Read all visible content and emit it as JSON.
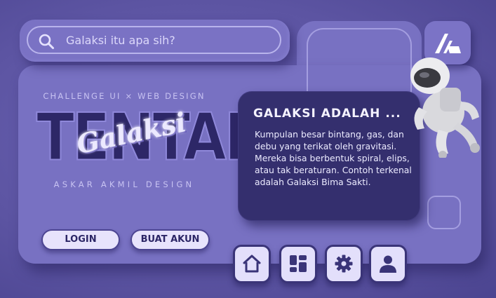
{
  "search": {
    "placeholder": "Galaksi itu apa sih?",
    "icon": "search-icon"
  },
  "hero": {
    "subtitle": "CHALLENGE UI × WEB DESIGN",
    "title": "TENTANG",
    "script_title": "Galaksi",
    "credit": "ASKAR AKMIL DESIGN"
  },
  "buttons": {
    "login": "LOGIN",
    "register": "BUAT AKUN"
  },
  "info": {
    "title": "GALAKSI ADALAH ...",
    "body": "Kumpulan besar bintang, gas, dan debu yang terikat oleh gravitasi. Mereka bisa berbentuk spiral, elips, atau tak beraturan. Contoh terkenal adalah Galaksi Bima Sakti."
  },
  "nav": [
    "home-icon",
    "dashboard-icon",
    "settings-icon",
    "user-icon"
  ],
  "colors": {
    "background": "#5f58a6",
    "card": "#7871c2",
    "panel": "#342f6e",
    "button": "#e7e3fc",
    "text_dark": "#2c2666"
  }
}
